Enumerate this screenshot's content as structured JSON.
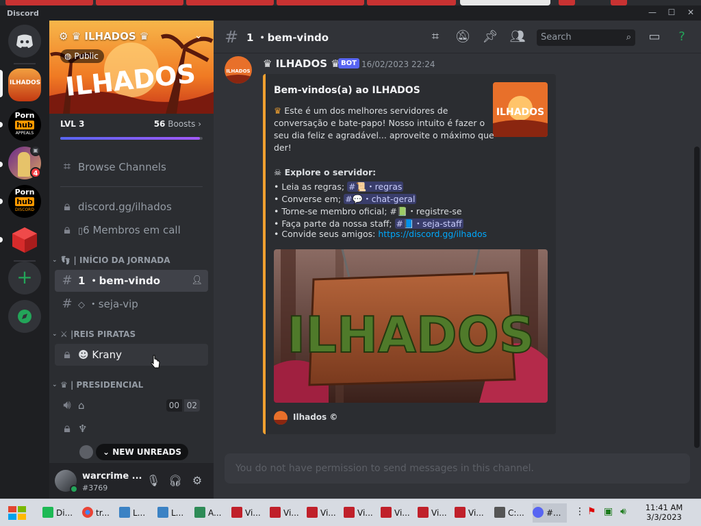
{
  "app": {
    "title": "Discord"
  },
  "colors": {
    "accent": "#5865f2",
    "embed_border": "#f0a030",
    "link": "#00a8fc",
    "danger": "#f23f43",
    "green": "#23a559"
  },
  "servers": [
    {
      "name": "ILHADOS",
      "icon_text": "ILHADOS"
    },
    {
      "name": "Porn hub Appeals",
      "icon_text_top": "Porn",
      "icon_text_bot": "hub",
      "icon_sub": "APPEALS"
    },
    {
      "name": "Avatar server",
      "badge": "4"
    },
    {
      "name": "Porn hub Discord",
      "icon_text_top": "Porn",
      "icon_text_bot": "hub",
      "icon_sub": "DISCORD"
    },
    {
      "name": "Roblox cube server"
    }
  ],
  "sidebar": {
    "server_name": "ILHADOS",
    "public_label": "Public",
    "level": "LVL 3",
    "boosts_count": "56",
    "boosts_label": "Boosts",
    "boost_progress": 0.98,
    "browse_channels": "Browse Channels",
    "invite_channel": "discord.gg/ilhados",
    "members_call": "6 Membros em call",
    "cat_jornada": "| INÍCIO DA JORNADA",
    "ch_bem_vindo": "1 ・bem-vindo",
    "ch_seja_vip": "・seja-vip",
    "cat_piratas": "|REIS PIRATAS",
    "ch_krany": "Krany",
    "cat_presidencial": "| PRESIDENCIAL",
    "voice_count_a": "00",
    "voice_count_b": "02",
    "new_unreads": "NEW UNREADS"
  },
  "user": {
    "name": "warcrime ...",
    "tag": "#3769"
  },
  "channel_header": {
    "title": "1 ・bem-vindo",
    "search_placeholder": "Search"
  },
  "message": {
    "author": "ILHADOS",
    "bot_tag": "BOT",
    "timestamp": "16/02/2023 22:24",
    "embed": {
      "title": "Bem-vindos(a) ao ILHADOS",
      "intro_1": "Este é um dos melhores servidores de",
      "intro_2": "conversação e bate-papo! Nosso intuito é fazer o",
      "intro_3": "seu dia feliz e agradável... aproveite o máximo que",
      "intro_4": "der!",
      "explore": "Explore o servidor:",
      "lines": [
        {
          "text": "• Leia as regras; ",
          "mention": "#📜・regras"
        },
        {
          "text": "• Converse em; ",
          "mention": "#💬・chat-geral"
        },
        {
          "text": "• Torne-se membro oficial; #📗・registre-se",
          "mention": ""
        },
        {
          "text": "• Faça parte da nossa staff; ",
          "mention": "#📘・seja-staff"
        },
        {
          "text": "• Convide seus amigos: ",
          "link": "https://discord.gg/ilhados"
        }
      ],
      "image_text": "ILHADOS",
      "thumb_text": "ILHADOS",
      "footer": "Ilhados ©"
    }
  },
  "composer": {
    "placeholder": "You do not have permission to send messages in this channel."
  },
  "taskbar": {
    "items": [
      "Di...",
      "tr...",
      "L...",
      "L...",
      "A...",
      "Vi...",
      "Vi...",
      "Vi...",
      "Vi...",
      "Vi...",
      "Vi...",
      "Vi...",
      "C:...",
      "#..."
    ],
    "time": "11:41 AM",
    "date": "3/3/2023"
  }
}
